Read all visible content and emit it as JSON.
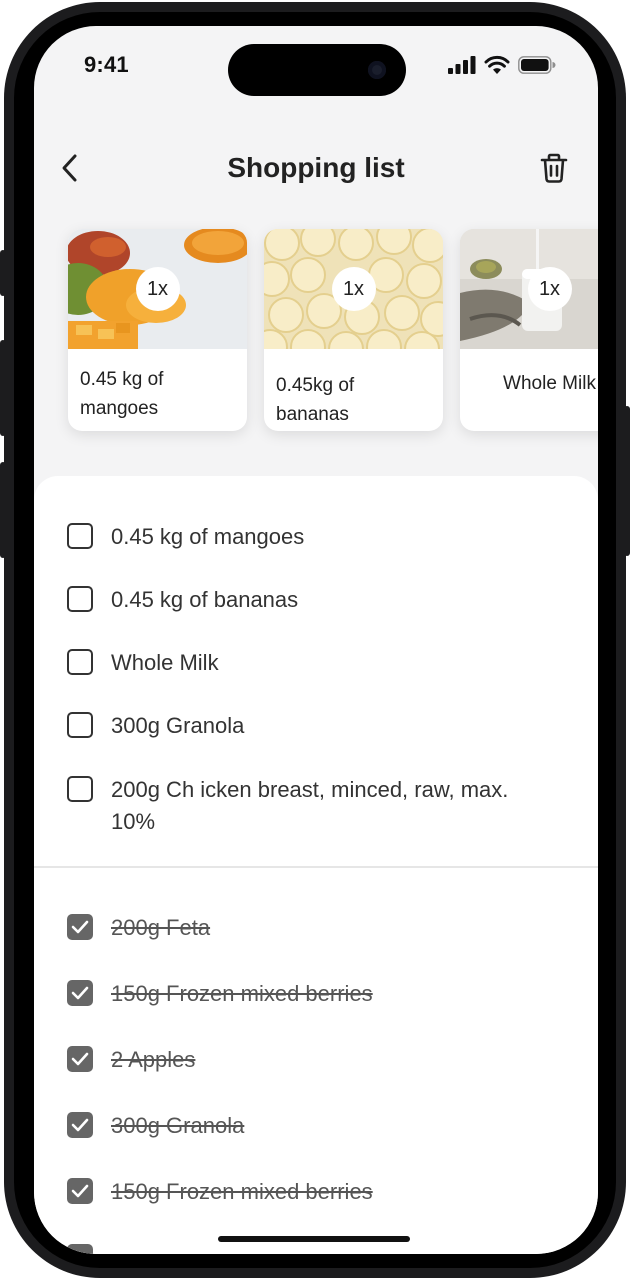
{
  "status_bar": {
    "time": "9:41"
  },
  "header": {
    "title": "Shopping list"
  },
  "cards": [
    {
      "quantity": "1x",
      "label": "0.45 kg of mangoes"
    },
    {
      "quantity": "1x",
      "label": "0.45kg of bananas"
    },
    {
      "quantity": "1x",
      "label": "Whole Milk"
    }
  ],
  "todo_items": [
    "0.45 kg of mangoes",
    "0.45 kg of bananas",
    "Whole Milk",
    "300g Granola",
    "200g Ch icken breast, minced, raw, max. 10%"
  ],
  "done_items": [
    "200g Feta",
    "150g Frozen mixed berries",
    "2 Apples",
    "300g Granola",
    "150g Frozen mixed berries"
  ]
}
